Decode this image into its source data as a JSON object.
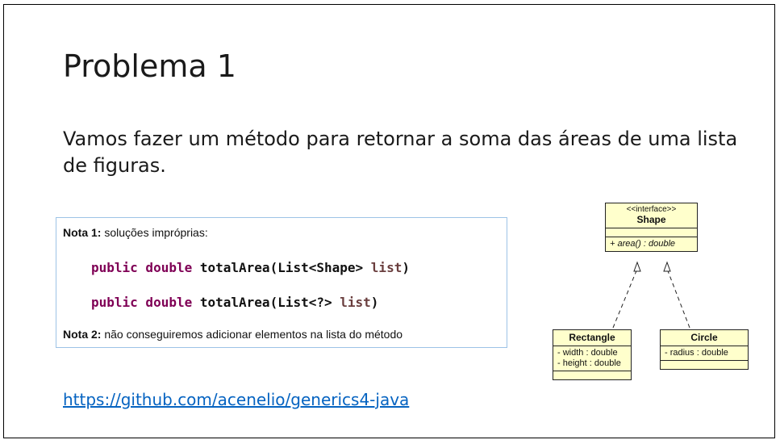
{
  "slide": {
    "title": "Problema 1",
    "intro": "Vamos fazer um método para retornar a soma das áreas de uma lista de figuras.",
    "note_box": {
      "note1_label": "Nota 1:",
      "note1_text": " soluções impróprias:",
      "code1": {
        "kw": "public double",
        "method": " totalArea(List<Shape> ",
        "param": "list",
        "close": ")"
      },
      "code2": {
        "kw": "public double",
        "method": " totalArea(List<?> ",
        "param": "list",
        "close": ")"
      },
      "note2_label": "Nota 2:",
      "note2_text": " não conseguiremos adicionar elementos na lista do método"
    },
    "link": "https://github.com/acenelio/generics4-java"
  },
  "uml": {
    "shape": {
      "stereotype": "<<interface>>",
      "name": "Shape",
      "operation": "+ area() : double"
    },
    "rectangle": {
      "name": "Rectangle",
      "attr1": "- width : double",
      "attr2": "- height : double"
    },
    "circle": {
      "name": "Circle",
      "attr1": "- radius : double"
    }
  },
  "colors": {
    "keyword": "#7f0055",
    "param": "#6a3e3e",
    "link": "#0563c1",
    "uml_fill": "#ffffcc",
    "note_border": "#9dc3e6"
  }
}
